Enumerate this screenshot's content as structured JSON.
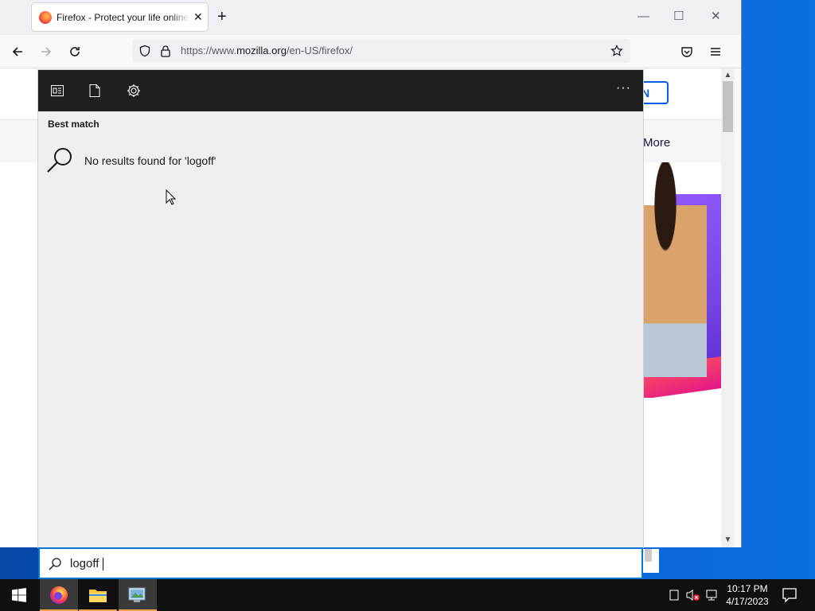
{
  "browser": {
    "tab_title": "Firefox - Protect your life online with privacy-first products",
    "url_prefix": "https://www.",
    "url_domain": "mozilla.org",
    "url_path": "/en-US/firefox/",
    "page_button_label": "N",
    "page_more_label": "More"
  },
  "search_panel": {
    "section_title": "Best match",
    "no_results_text": "No results found for 'logoff'",
    "more_label": "···"
  },
  "search_box": {
    "value": "logoff"
  },
  "taskbar": {
    "clock_time": "10:17 PM",
    "clock_date": "4/17/2023",
    "apps": [
      "firefox-icon",
      "file-explorer-icon",
      "control-panel-icon"
    ]
  },
  "colors": {
    "accent": "#0078d7",
    "taskbar": "#101010",
    "panel_toolbar": "#1f1f1f",
    "firefox_blue": "#0060df"
  }
}
